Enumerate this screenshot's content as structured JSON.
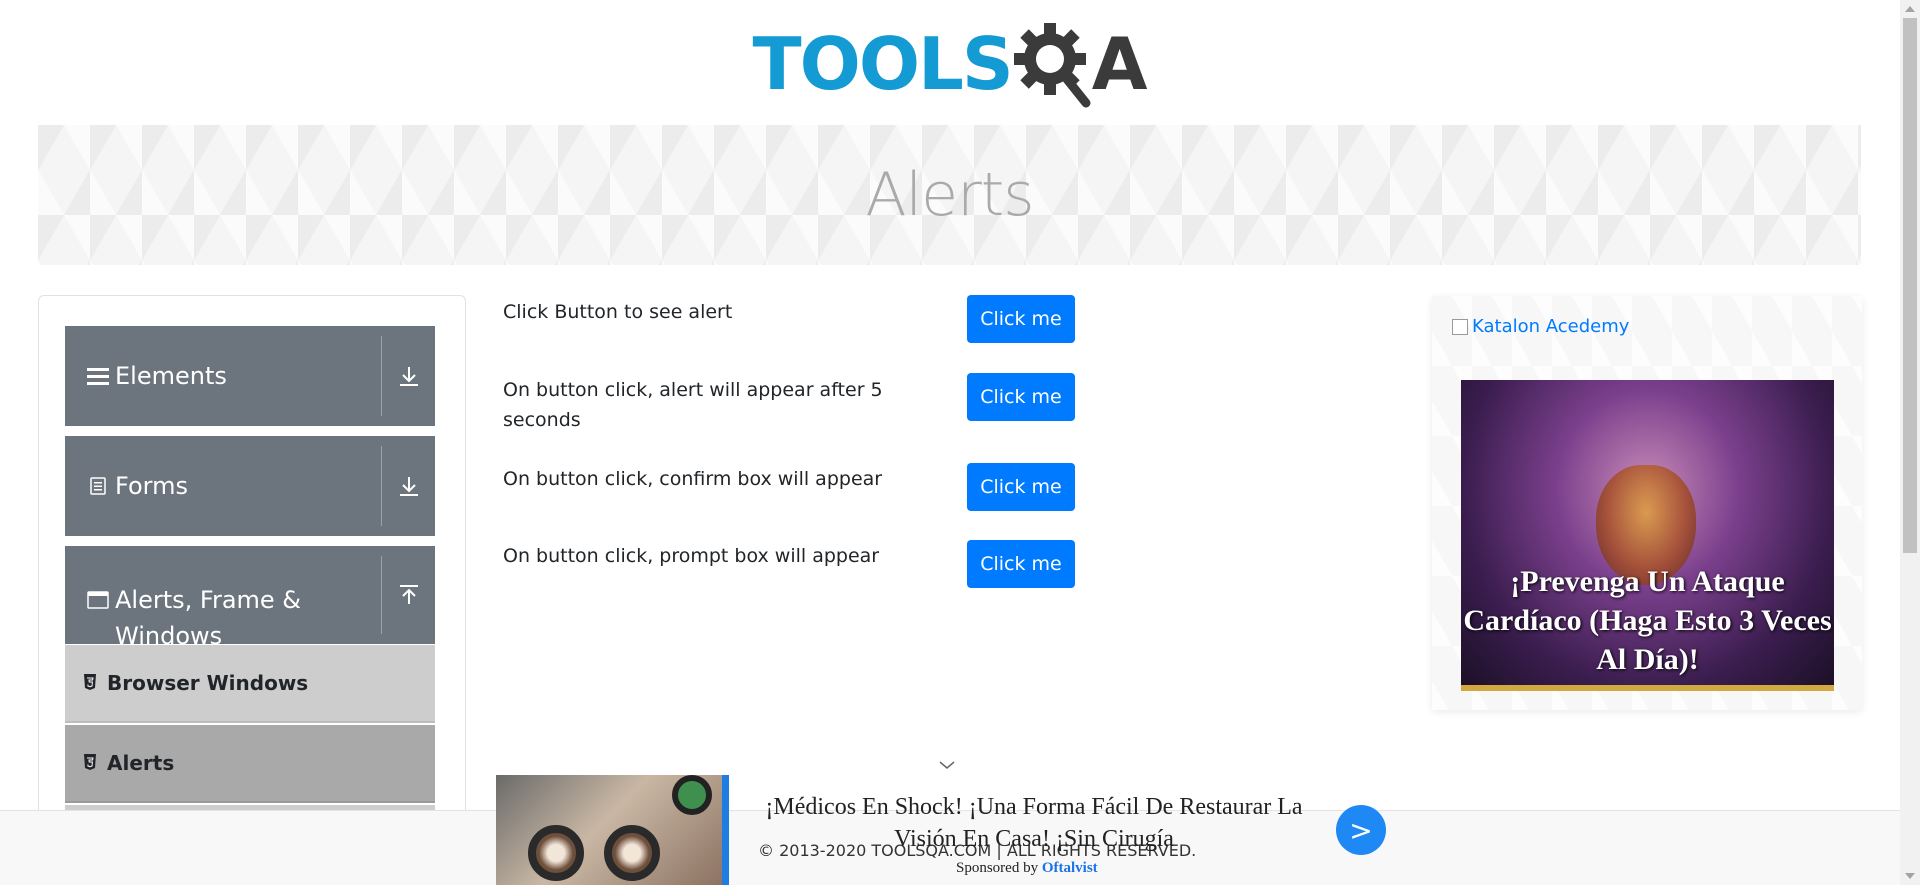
{
  "logo": {
    "text": "TOOLS",
    "accent": "A",
    "brand_blue": "#149bd3",
    "brand_dark": "#3b3b3b"
  },
  "banner": {
    "title": "Alerts"
  },
  "sidebar": {
    "groups": [
      {
        "label": "Elements",
        "icon": "hamburger-icon",
        "toggle_icon": "download-arrow-icon"
      },
      {
        "label": "Forms",
        "icon": "document-icon",
        "toggle_icon": "download-arrow-icon"
      },
      {
        "label_line1": "Alerts, Frame &",
        "label_line2": "Windows",
        "icon": "window-icon",
        "toggle_icon": "upload-arrow-icon"
      }
    ],
    "sub_items": [
      {
        "label": "Browser Windows",
        "icon": "html5-icon"
      },
      {
        "label": "Alerts",
        "icon": "html5-icon",
        "active": true
      }
    ]
  },
  "main": {
    "rows": [
      {
        "text": "Click Button to see alert",
        "button": "Click me"
      },
      {
        "text": "On button click, alert will appear after 5 seconds",
        "button": "Click me"
      },
      {
        "text": "On button click, confirm box will appear",
        "button": "Click me"
      },
      {
        "text": "On button click, prompt box will appear",
        "button": "Click me"
      }
    ]
  },
  "side_ad": {
    "link_text": "Katalon Acedemy",
    "caption": "¡Prevenga Un Ataque Cardíaco (Haga Esto 3 Veces Al Día)!"
  },
  "bottom_ad": {
    "headline": "¡Médicos En Shock! ¡Una Forma Fácil De Restaurar La Visión En Casa! ¡Sin Cirugía",
    "sponsored_prefix": "Sponsored by",
    "sponsor": "Oftalvist",
    "arrow": ">"
  },
  "footer": {
    "copyright": "© 2013-2020 TOOLSQA.COM | ALL RIGHTS RESERVED."
  },
  "colors": {
    "primary_button": "#007bff",
    "sidebar_group": "#6c757d",
    "active_sub": "#a9a9a9"
  }
}
